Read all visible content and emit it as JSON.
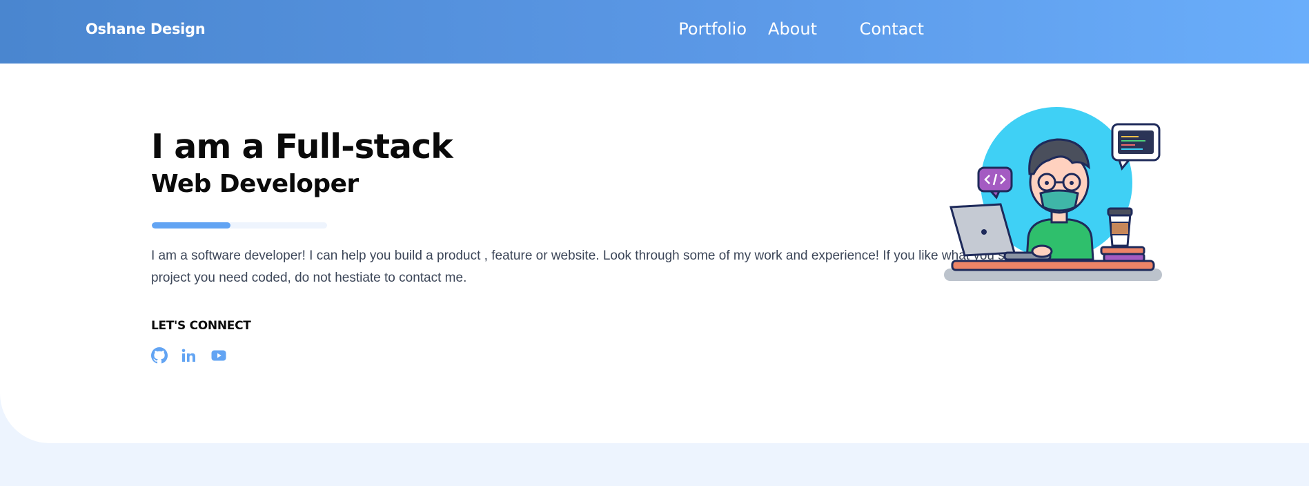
{
  "nav": {
    "brand": "Oshane Design",
    "links": [
      {
        "label": "Portfolio"
      },
      {
        "label": "About"
      },
      {
        "label": "Contact"
      }
    ]
  },
  "hero": {
    "title_line1": "I am a Full-stack",
    "title_line2": "Web Developer",
    "progress": 0.45,
    "intro": "I am a software developer! I can help you build a product , feature or website. Look through some of my work and experience! If you like what you see and have a project you need coded, do not hestiate to contact me.",
    "connect_heading": "LET'S CONNECT",
    "socials": [
      {
        "icon": "github-icon"
      },
      {
        "icon": "linkedin-icon"
      },
      {
        "icon": "youtube-icon"
      }
    ]
  },
  "colors": {
    "nav_gradient_start": "#4a86cf",
    "nav_gradient_end": "#6aaefb",
    "accent": "#62a4f3",
    "page_background": "#edf4fe",
    "body_text": "#3c4658",
    "heading_text": "#0a0a0a"
  }
}
